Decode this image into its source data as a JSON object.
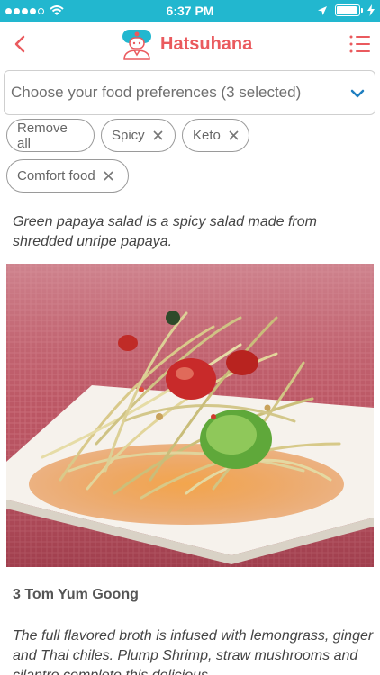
{
  "status_bar": {
    "time": "6:37 PM",
    "battery_level": 0.9
  },
  "header": {
    "title": "Hatsuhana"
  },
  "colors": {
    "status_bar": "#22b7cf",
    "brand": "#ea5a5e",
    "chevron": "#1f7fc0"
  },
  "filter": {
    "placeholder": "Choose your food preferences (3 selected)",
    "chips": [
      "Remove all",
      "Spicy",
      "Keto",
      "Comfort food"
    ]
  },
  "items": [
    {
      "description": "Green papaya salad is a spicy salad made from shredded unripe papaya."
    },
    {
      "title": "3 Tom Yum Goong",
      "description": "The full flavored broth is infused with lemongrass, ginger and Thai chiles. Plump Shrimp, straw mushrooms and cilantro complete this delicious"
    }
  ],
  "icons": [
    "signal-dots-icon",
    "wifi-icon",
    "location-arrow-icon",
    "battery-icon",
    "back-chevron-icon",
    "chef-logo-icon",
    "menu-list-icon",
    "chevron-down-icon",
    "remove-chip-icon"
  ]
}
